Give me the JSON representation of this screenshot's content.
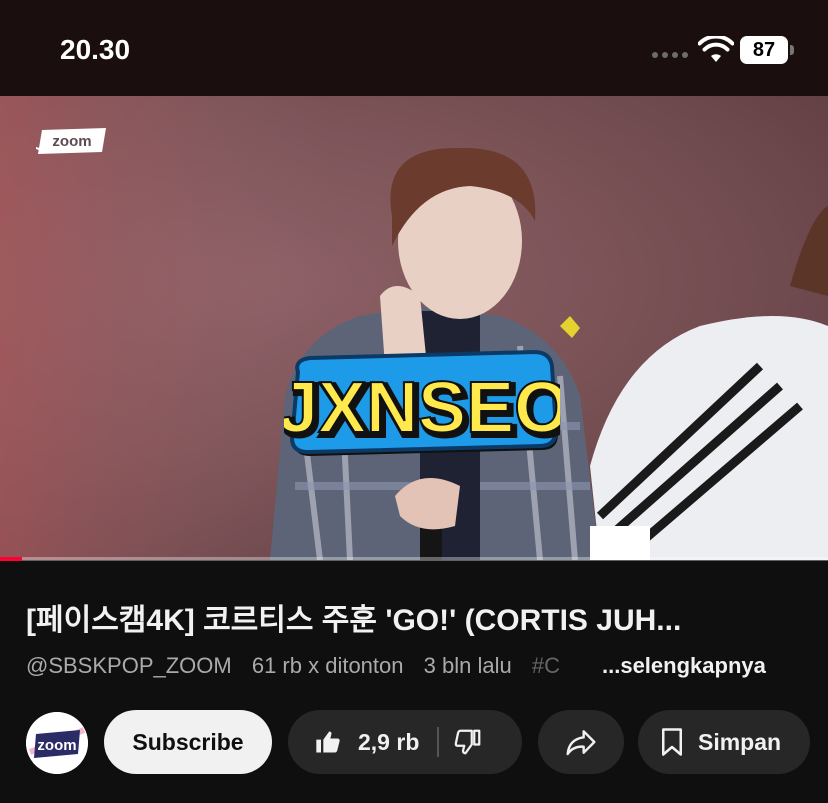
{
  "status_bar": {
    "time": "20.30",
    "battery": "87"
  },
  "video": {
    "channel_watermark": "zoom",
    "sticker_text": "JXNSEO",
    "progress_fraction": 0.027
  },
  "info": {
    "title": "[페이스캠4K] 코르티스 주훈 'GO!' (CORTIS JUH...",
    "channel_handle": "@SBSKPOP_ZOOM",
    "views": "61 rb x ditonton",
    "age": "3 bln lalu",
    "hashtag_fragment": "#C",
    "more_label": "...selengkapnya"
  },
  "actions": {
    "avatar_text": "zoom",
    "subscribe_label": "Subscribe",
    "like_count": "2,9 rb",
    "save_label": "Simpan"
  },
  "icons": {
    "wifi": "wifi-icon",
    "like": "thumbs-up-icon",
    "dislike": "thumbs-down-icon",
    "share": "share-arrow-icon",
    "save": "bookmark-icon"
  },
  "colors": {
    "background": "#0f0f0f",
    "pill": "#272727",
    "subscribe_bg": "#f1f1f1",
    "progress": "#ff0033",
    "sticker_blue": "#1e9be8",
    "sticker_yellow": "#ffe94d"
  }
}
